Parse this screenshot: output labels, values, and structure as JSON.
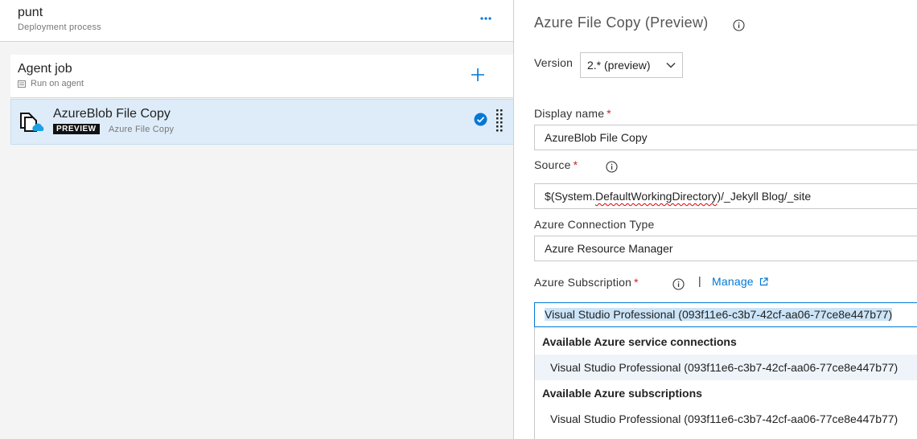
{
  "left": {
    "pipeline_name": "punt",
    "pipeline_subtitle": "Deployment process",
    "more_label": "···",
    "agent_job": {
      "title": "Agent job",
      "subtitle": "Run on agent"
    },
    "task": {
      "title": "AzureBlob File Copy",
      "badge": "PREVIEW",
      "subtitle": "Azure File Copy"
    }
  },
  "right": {
    "title": "Azure File Copy (Preview)",
    "version_label": "Version",
    "version_value": "2.* (preview)",
    "display_name_label": "Display name",
    "display_name_value": "AzureBlob File Copy",
    "source_label": "Source",
    "source_prefix": "$(System.",
    "source_misspelled": "DefaultWorkingDirectory",
    "source_suffix": ")/_Jekyll Blog/_site",
    "connection_type_label": "Azure Connection Type",
    "connection_type_value": "Azure Resource Manager",
    "subscription_label": "Azure Subscription",
    "separator": "|",
    "manage_label": "Manage",
    "subscription_value": "Visual Studio Professional (093f11e6-c3b7-42cf-aa06-77ce8e447b77)",
    "required_marker": "*",
    "dropdown": {
      "group1_header": "Available Azure service connections",
      "group1_items": [
        "Visual Studio Professional (093f11e6-c3b7-42cf-aa06-77ce8e447b77)"
      ],
      "group2_header": "Available Azure subscriptions",
      "group2_items": [
        "Visual Studio Professional (093f11e6-c3b7-42cf-aa06-77ce8e447b77)"
      ]
    }
  },
  "colors": {
    "accent": "#0078d4",
    "required": "#c5262c",
    "selected_row": "#deecf9"
  }
}
